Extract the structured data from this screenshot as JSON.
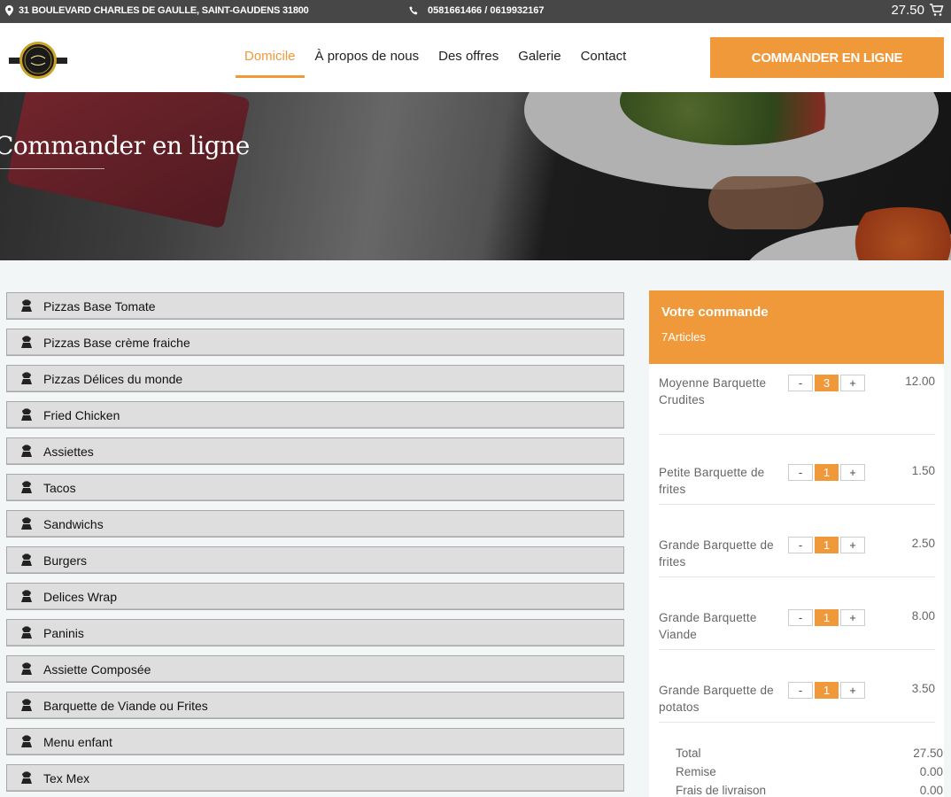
{
  "topbar": {
    "address": "31 BOULEVARD CHARLES DE GAULLE, SAINT-GAUDENS 31800",
    "phone": "0581661466 / 0619932167",
    "cart_total": "27.50"
  },
  "header": {
    "nav": [
      "Domicile",
      "À propos de nous",
      "Des offres",
      "Galerie",
      "Contact"
    ],
    "active_nav": "Domicile",
    "cta_label": "COMMANDER EN LIGNE"
  },
  "hero": {
    "title": "Commander en ligne"
  },
  "categories": [
    "Pizzas Base Tomate",
    "Pizzas Base crème fraiche",
    "Pizzas Délices du monde",
    "Fried Chicken",
    "Assiettes",
    "Tacos",
    "Sandwichs",
    "Burgers",
    "Delices Wrap",
    "Paninis",
    "Assiette Composée",
    "Barquette de Viande ou Frites",
    "Menu enfant",
    "Tex Mex"
  ],
  "order": {
    "title": "Votre commande",
    "count": "7Articles",
    "items": [
      {
        "name": "Moyenne Barquette Crudites",
        "qty": "3",
        "price": "12.00"
      },
      {
        "name": "Petite Barquette de frites",
        "qty": "1",
        "price": "1.50"
      },
      {
        "name": "Grande Barquette de frites",
        "qty": "1",
        "price": "2.50"
      },
      {
        "name": "Grande Barquette Viande",
        "qty": "1",
        "price": "8.00"
      },
      {
        "name": "Grande Barquette de potatos",
        "qty": "1",
        "price": "3.50"
      }
    ],
    "minus": "-",
    "plus": "+",
    "totals": [
      {
        "label": "Total",
        "value": "27.50"
      },
      {
        "label": "Remise",
        "value": "0.00"
      },
      {
        "label": "Frais de livraison",
        "value": "0.00"
      }
    ]
  },
  "colors": {
    "accent": "#f0993a",
    "topbar": "#474747"
  }
}
